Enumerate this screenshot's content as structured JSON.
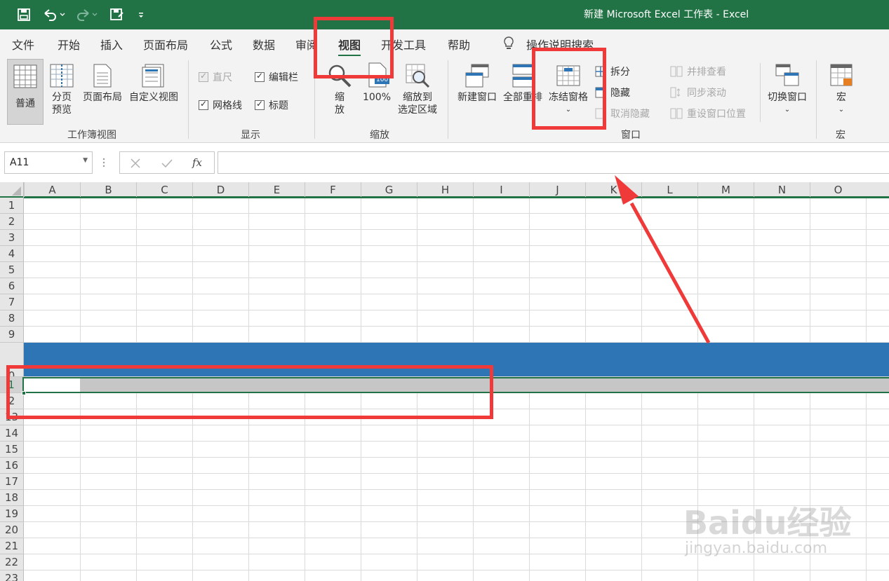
{
  "window": {
    "title": "新建 Microsoft Excel 工作表  -  Excel"
  },
  "menu": {
    "tabs": [
      "文件",
      "开始",
      "插入",
      "页面布局",
      "公式",
      "数据",
      "审阅",
      "视图",
      "开发工具",
      "帮助"
    ],
    "active_tab": "视图",
    "search_hint": "操作说明搜索"
  },
  "ribbon": {
    "workbook_views": {
      "label": "工作簿视图",
      "normal": "普通",
      "page_break_l1": "分页",
      "page_break_l2": "预览",
      "page_layout": "页面布局",
      "custom_views": "自定义视图"
    },
    "show": {
      "label": "显示",
      "ruler": "直尺",
      "formula_bar": "编辑栏",
      "gridlines": "网格线",
      "headings": "标题"
    },
    "zoom": {
      "label": "缩放",
      "zoom_l1": "缩",
      "zoom_l2": "放",
      "hundred": "100%",
      "hundred_icon_text": "100",
      "selection_l1": "缩放到",
      "selection_l2": "选定区域"
    },
    "window": {
      "label": "窗口",
      "new_window": "新建窗口",
      "arrange_all": "全部重排",
      "freeze_panes": "冻结窗格",
      "split": "拆分",
      "hide": "隐藏",
      "unhide": "取消隐藏",
      "side_by_side": "并排查看",
      "sync_scroll": "同步滚动",
      "reset_position": "重设窗口位置",
      "switch_windows": "切换窗口"
    },
    "macros": {
      "label": "宏",
      "macros": "宏"
    }
  },
  "formula_bar": {
    "name_box": "A11",
    "fx": "fx",
    "value": ""
  },
  "sheet": {
    "columns": [
      "A",
      "B",
      "C",
      "D",
      "E",
      "F",
      "G",
      "H",
      "I",
      "J",
      "K",
      "L",
      "M",
      "N",
      "O"
    ],
    "rows_top": [
      "1",
      "2",
      "3",
      "4",
      "5",
      "6",
      "7",
      "8",
      "9"
    ],
    "row_partial": "0",
    "row_11": "1",
    "row_12": "2",
    "rows_bottom": [
      "13",
      "14",
      "15",
      "16",
      "17",
      "18",
      "19",
      "20",
      "21",
      "22",
      "23"
    ]
  },
  "watermark": {
    "brand": "Baidu经验",
    "url": "jingyan.baidu.com"
  },
  "colors": {
    "excel_green": "#217346",
    "frozen_bar": "#2e75b6",
    "annotation": "#f03a3a"
  }
}
